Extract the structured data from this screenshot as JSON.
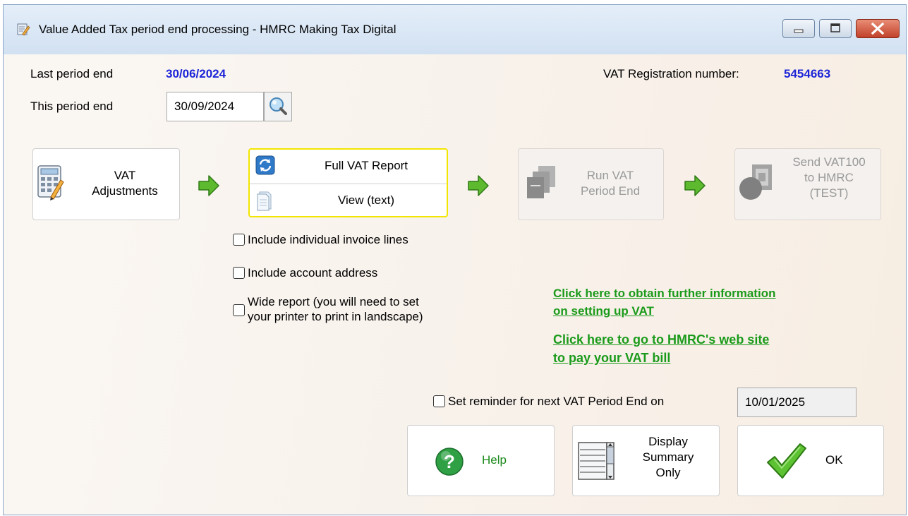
{
  "window": {
    "title": "Value Added Tax period end processing - HMRC Making Tax Digital"
  },
  "header": {
    "last_period_label": "Last period end",
    "last_period_value": "30/06/2024",
    "vat_reg_label": "VAT Registration number:",
    "vat_reg_value": "5454663",
    "this_period_label": "This period end",
    "this_period_value": "30/09/2024"
  },
  "steps": {
    "vat_adjustments": {
      "line1": "VAT",
      "line2": "Adjustments"
    },
    "full_vat_report": "Full VAT Report",
    "view_text": "View (text)",
    "run_period_end": {
      "line1": "Run VAT",
      "line2": "Period End"
    },
    "send_vat100": {
      "line1": "Send VAT100",
      "line2": "to HMRC",
      "line3": "(TEST)"
    }
  },
  "options": {
    "include_invoice_lines": "Include individual invoice lines",
    "include_account_address": "Include account address",
    "wide_report_line1": "Wide report (you will need to set",
    "wide_report_line2": "your printer to print in landscape)"
  },
  "links": {
    "info_line1": "Click here to obtain further information",
    "info_line2": "on setting up VAT",
    "hmrc_line1": "Click here to go to HMRC's web site",
    "hmrc_line2": "to pay your VAT bill"
  },
  "reminder": {
    "label": "Set reminder for next VAT Period End on",
    "date": "10/01/2025"
  },
  "buttons": {
    "help": "Help",
    "display_summary": {
      "line1": "Display",
      "line2": "Summary",
      "line3": "Only"
    },
    "ok": "OK"
  },
  "colors": {
    "accent_blue": "#1c24d8",
    "link_green": "#1a9a1a",
    "arrow_green": "#5dba2f",
    "highlight_yellow": "#f2e600"
  }
}
